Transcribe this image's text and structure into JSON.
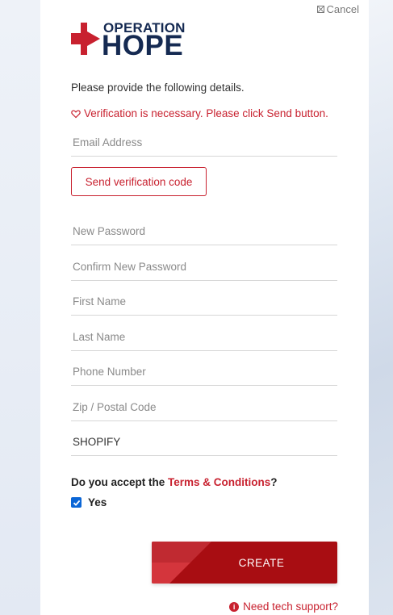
{
  "cancel": {
    "label": "Cancel"
  },
  "logo": {
    "line1": "OPERATION",
    "line2": "HOPE"
  },
  "intro": "Please provide the following details.",
  "verification_message": "Verification is necessary. Please click Send button.",
  "fields": {
    "email": {
      "placeholder": "Email Address",
      "value": ""
    },
    "new_password": {
      "placeholder": "New Password",
      "value": ""
    },
    "confirm_password": {
      "placeholder": "Confirm New Password",
      "value": ""
    },
    "first_name": {
      "placeholder": "First Name",
      "value": ""
    },
    "last_name": {
      "placeholder": "Last Name",
      "value": ""
    },
    "phone": {
      "placeholder": "Phone Number",
      "value": ""
    },
    "zip": {
      "placeholder": "Zip / Postal Code",
      "value": ""
    },
    "source": {
      "placeholder": "",
      "value": "SHOPIFY"
    }
  },
  "send_button": "Send verification code",
  "terms": {
    "prefix": "Do you accept the ",
    "link": "Terms & Conditions",
    "suffix": "?"
  },
  "accept": {
    "label": "Yes",
    "checked": true
  },
  "create_button": "CREATE",
  "support_link": "Need tech support?",
  "colors": {
    "brand_red": "#c8212f",
    "dark_red": "#a80d12",
    "navy": "#152a52",
    "checkbox_blue": "#0b66d6"
  }
}
